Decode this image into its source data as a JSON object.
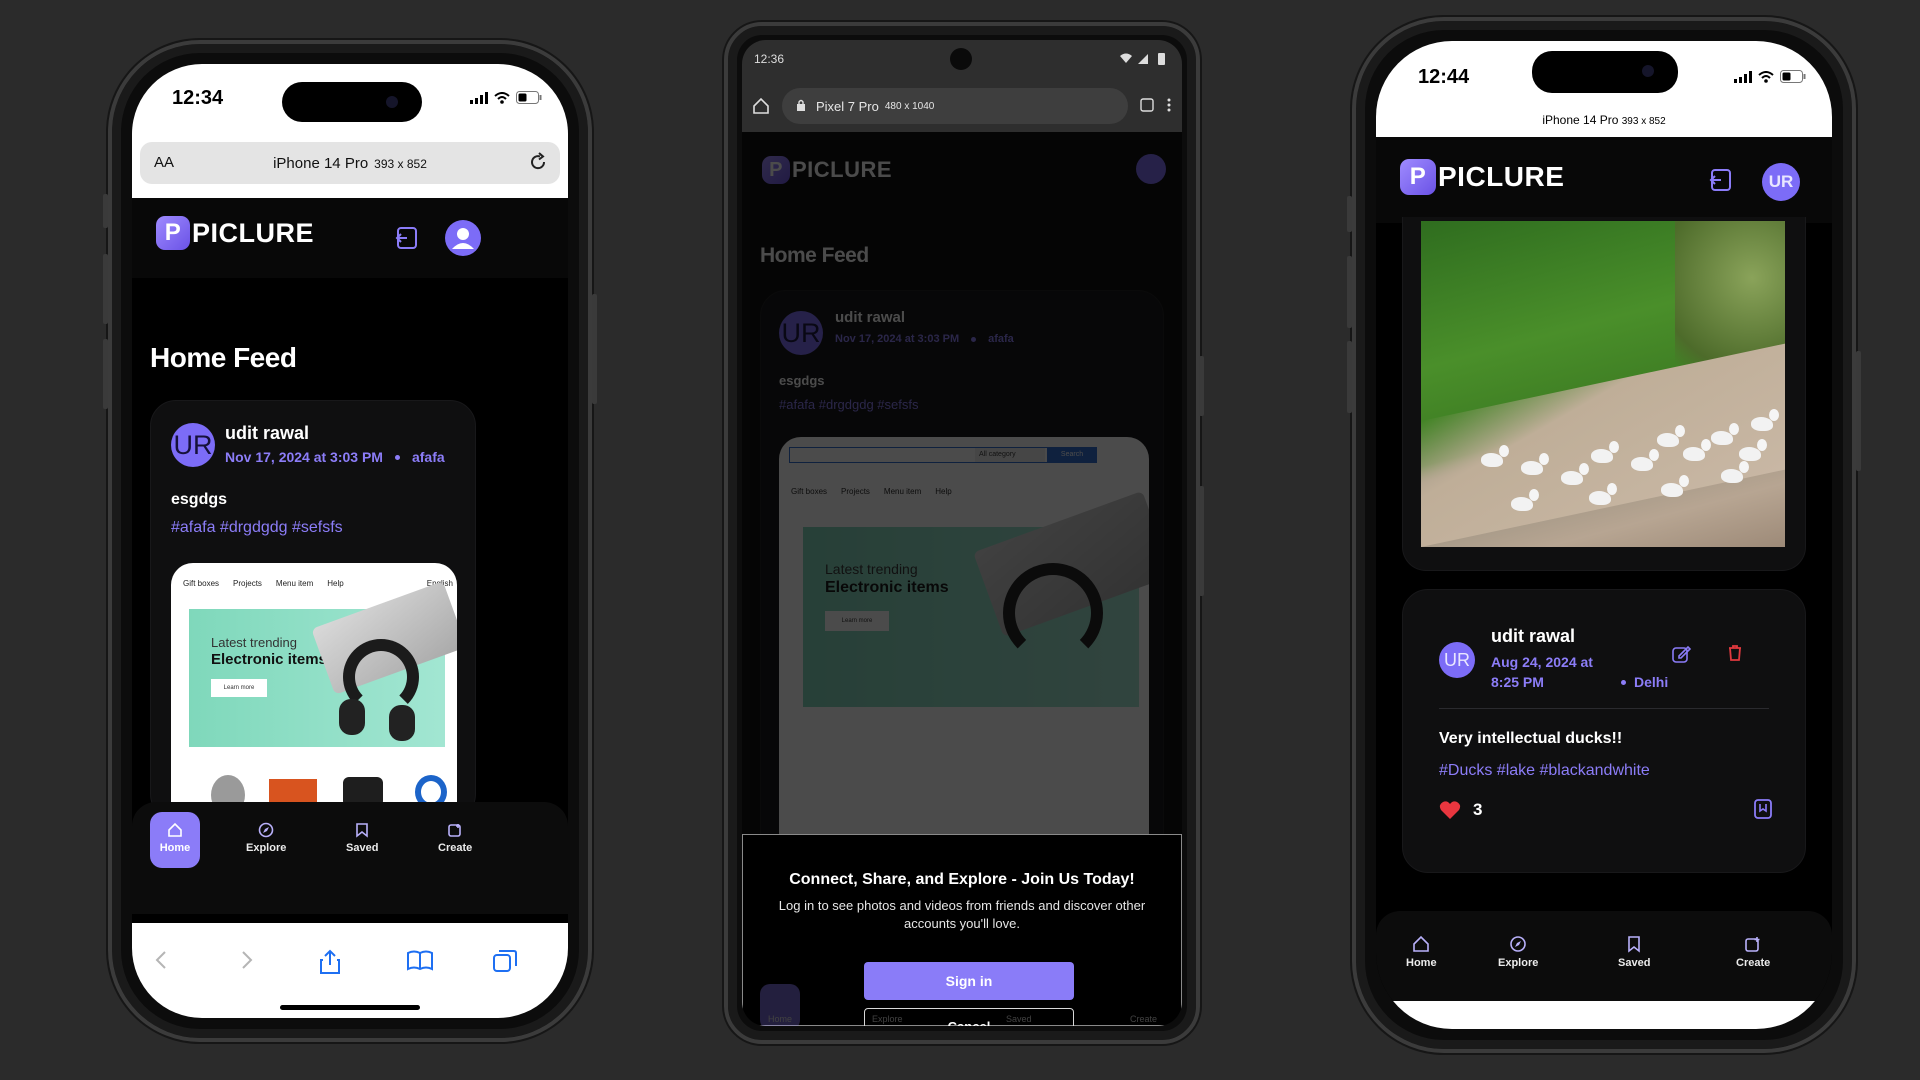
{
  "brand": {
    "name": "PICLURE",
    "letter": "P"
  },
  "phone1": {
    "time": "12:34",
    "url_text_size": "AA",
    "device": "iPhone 14 Pro",
    "device_size": "393 x 852",
    "page_title": "Home Feed",
    "post": {
      "avatar": "UR",
      "user": "udit rawal",
      "date": "Nov 17, 2024 at 3:03 PM",
      "location": "afafa",
      "caption": "esgdgs",
      "tags": "#afafa #drgdgdg #sefsfs",
      "image": {
        "nav": [
          "Gift boxes",
          "Projects",
          "Menu item",
          "Help"
        ],
        "lang": "English",
        "headline_1": "Latest trending",
        "headline_2": "Electronic items",
        "cta": "Learn more"
      }
    },
    "tabs": [
      {
        "label": "Home",
        "icon": "home-icon",
        "active": true
      },
      {
        "label": "Explore",
        "icon": "explore-icon",
        "active": false
      },
      {
        "label": "Saved",
        "icon": "bookmark-icon",
        "active": false
      },
      {
        "label": "Create",
        "icon": "create-icon",
        "active": false
      }
    ]
  },
  "phone2": {
    "time": "12:36",
    "device": "Pixel 7 Pro",
    "device_size": "480 x 1040",
    "page_title": "Home Feed",
    "post": {
      "avatar": "UR",
      "user": "udit rawal",
      "date": "Nov 17, 2024 at 3:03 PM",
      "location": "afafa",
      "caption": "esgdgs",
      "tags": "#afafa #drgdgdg #sefsfs",
      "search_category": "All category",
      "search_button": "Search"
    },
    "modal": {
      "heading": "Connect, Share, and Explore - Join Us Today!",
      "text": "Log in to see photos and videos from friends and discover other accounts you'll love.",
      "signin": "Sign in",
      "cancel": "Cancel"
    },
    "tabs": [
      "Home",
      "Explore",
      "Saved",
      "Create"
    ]
  },
  "phone3": {
    "time": "12:44",
    "device": "iPhone 14 Pro",
    "device_size": "393 x 852",
    "post": {
      "avatar": "UR",
      "user": "udit rawal",
      "date_line1": "Aug 24, 2024 at",
      "date_line2": "8:25 PM",
      "location": "Delhi",
      "caption": "Very intellectual ducks!!",
      "tags": "#Ducks #lake #blackandwhite",
      "likes": "3"
    },
    "tabs": [
      "Home",
      "Explore",
      "Saved",
      "Create"
    ]
  },
  "colors": {
    "accent": "#8b7cf8",
    "background": "#2b2b2b",
    "delete": "#e0393e",
    "like": "#e8363f"
  }
}
